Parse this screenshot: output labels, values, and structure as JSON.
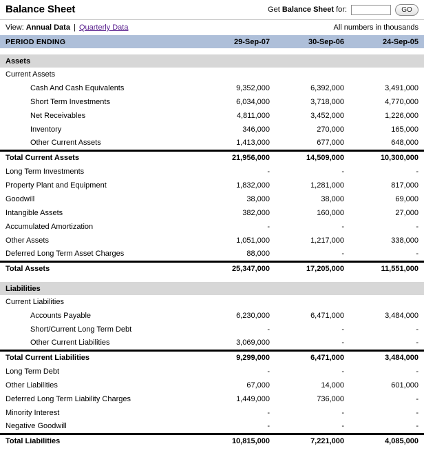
{
  "header": {
    "title": "Balance Sheet",
    "get_prefix": "Get ",
    "get_bold": "Balance Sheet",
    "get_suffix": " for:",
    "ticker_value": "",
    "ticker_placeholder": "",
    "go_label": "GO"
  },
  "viewbar": {
    "view_label": "View:",
    "annual_label": "Annual Data",
    "separator": "|",
    "quarterly_label": "Quarterly Data",
    "units_note": "All numbers in thousands"
  },
  "colors": {
    "period_bar": "#aebfd9",
    "section_bar": "#d7d7d7",
    "link": "#551a8b",
    "rule": "#000000"
  },
  "table": {
    "period_header_label": "PERIOD ENDING",
    "periods": [
      "29-Sep-07",
      "30-Sep-06",
      "24-Sep-05"
    ],
    "sections": [
      {
        "name": "Assets",
        "rows": [
          {
            "label": "Current Assets",
            "indent": 0,
            "values": [
              "",
              "",
              ""
            ],
            "type": "item"
          },
          {
            "label": "Cash And Cash Equivalents",
            "indent": 1,
            "values": [
              "9,352,000",
              "6,392,000",
              "3,491,000"
            ],
            "type": "item"
          },
          {
            "label": "Short Term Investments",
            "indent": 1,
            "values": [
              "6,034,000",
              "3,718,000",
              "4,770,000"
            ],
            "type": "item"
          },
          {
            "label": "Net Receivables",
            "indent": 1,
            "values": [
              "4,811,000",
              "3,452,000",
              "1,226,000"
            ],
            "type": "item"
          },
          {
            "label": "Inventory",
            "indent": 1,
            "values": [
              "346,000",
              "270,000",
              "165,000"
            ],
            "type": "item"
          },
          {
            "label": "Other Current Assets",
            "indent": 1,
            "values": [
              "1,413,000",
              "677,000",
              "648,000"
            ],
            "type": "item"
          },
          {
            "label": "Total Current Assets",
            "indent": 0,
            "values": [
              "21,956,000",
              "14,509,000",
              "10,300,000"
            ],
            "type": "total"
          },
          {
            "label": "Long Term Investments",
            "indent": 0,
            "values": [
              "-",
              "-",
              "-"
            ],
            "type": "item"
          },
          {
            "label": "Property Plant and Equipment",
            "indent": 0,
            "values": [
              "1,832,000",
              "1,281,000",
              "817,000"
            ],
            "type": "item"
          },
          {
            "label": "Goodwill",
            "indent": 0,
            "values": [
              "38,000",
              "38,000",
              "69,000"
            ],
            "type": "item"
          },
          {
            "label": "Intangible Assets",
            "indent": 0,
            "values": [
              "382,000",
              "160,000",
              "27,000"
            ],
            "type": "item"
          },
          {
            "label": "Accumulated Amortization",
            "indent": 0,
            "values": [
              "-",
              "-",
              "-"
            ],
            "type": "item"
          },
          {
            "label": "Other Assets",
            "indent": 0,
            "values": [
              "1,051,000",
              "1,217,000",
              "338,000"
            ],
            "type": "item"
          },
          {
            "label": "Deferred Long Term Asset Charges",
            "indent": 0,
            "values": [
              "88,000",
              "-",
              "-"
            ],
            "type": "item"
          },
          {
            "label": "Total Assets",
            "indent": 0,
            "values": [
              "25,347,000",
              "17,205,000",
              "11,551,000"
            ],
            "type": "total"
          }
        ]
      },
      {
        "name": "Liabilities",
        "rows": [
          {
            "label": "Current Liabilities",
            "indent": 0,
            "values": [
              "",
              "",
              ""
            ],
            "type": "item"
          },
          {
            "label": "Accounts Payable",
            "indent": 1,
            "values": [
              "6,230,000",
              "6,471,000",
              "3,484,000"
            ],
            "type": "item"
          },
          {
            "label": "Short/Current Long Term Debt",
            "indent": 1,
            "values": [
              "-",
              "-",
              "-"
            ],
            "type": "item"
          },
          {
            "label": "Other Current Liabilities",
            "indent": 1,
            "values": [
              "3,069,000",
              "-",
              "-"
            ],
            "type": "item"
          },
          {
            "label": "Total Current Liabilities",
            "indent": 0,
            "values": [
              "9,299,000",
              "6,471,000",
              "3,484,000"
            ],
            "type": "total"
          },
          {
            "label": "Long Term Debt",
            "indent": 0,
            "values": [
              "-",
              "-",
              "-"
            ],
            "type": "item"
          },
          {
            "label": "Other Liabilities",
            "indent": 0,
            "values": [
              "67,000",
              "14,000",
              "601,000"
            ],
            "type": "item"
          },
          {
            "label": "Deferred Long Term Liability Charges",
            "indent": 0,
            "values": [
              "1,449,000",
              "736,000",
              "-"
            ],
            "type": "item"
          },
          {
            "label": "Minority Interest",
            "indent": 0,
            "values": [
              "-",
              "-",
              "-"
            ],
            "type": "item"
          },
          {
            "label": "Negative Goodwill",
            "indent": 0,
            "values": [
              "-",
              "-",
              "-"
            ],
            "type": "item"
          },
          {
            "label": "Total Liabilities",
            "indent": 0,
            "values": [
              "10,815,000",
              "7,221,000",
              "4,085,000"
            ],
            "type": "total"
          }
        ]
      }
    ]
  }
}
